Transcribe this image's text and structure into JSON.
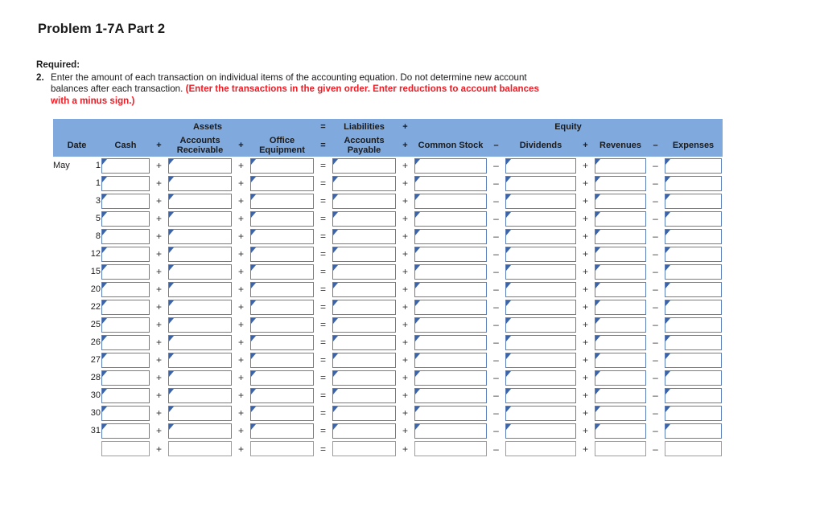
{
  "page_title": "Problem 1-7A Part 2",
  "instructions": {
    "required_label": "Required:",
    "item_number": "2.",
    "text_part1": "Enter the amount of each transaction on individual items of the accounting equation. Do not determine new account balances after each transaction. ",
    "text_emphasis": "(Enter the transactions in the given order. Enter reductions to account balances with a minus sign.)",
    "emphasis_color": "#ee1c25"
  },
  "table": {
    "header_bg": "#80a9dd",
    "input_border_color": "#5b7fbd",
    "group_headers": {
      "date_blank": "",
      "assets": "Assets",
      "eq1": "=",
      "liabilities": "Liabilities",
      "plus1": "+",
      "equity": "Equity"
    },
    "column_headers": {
      "date": "Date",
      "cash": "Cash",
      "op_plus_1": "+",
      "accounts_receivable": "Accounts Receivable",
      "op_plus_2": "+",
      "office_equipment": "Office Equipment",
      "op_equals": "=",
      "accounts_payable": "Accounts Payable",
      "op_plus_3": "+",
      "common_stock": "Common Stock",
      "op_minus_1": "–",
      "dividends": "Dividends",
      "op_plus_4": "+",
      "revenues": "Revenues",
      "op_minus_2": "–",
      "expenses": "Expenses"
    },
    "row_operators": {
      "plus": "+",
      "minus": "–",
      "equals": "="
    },
    "rows": [
      {
        "month": "May",
        "day": "1",
        "cash": "",
        "accounts_receivable": "",
        "office_equipment": "",
        "accounts_payable": "",
        "common_stock": "",
        "dividends": "",
        "revenues": "",
        "expenses": ""
      },
      {
        "month": "",
        "day": "1",
        "cash": "",
        "accounts_receivable": "",
        "office_equipment": "",
        "accounts_payable": "",
        "common_stock": "",
        "dividends": "",
        "revenues": "",
        "expenses": ""
      },
      {
        "month": "",
        "day": "3",
        "cash": "",
        "accounts_receivable": "",
        "office_equipment": "",
        "accounts_payable": "",
        "common_stock": "",
        "dividends": "",
        "revenues": "",
        "expenses": ""
      },
      {
        "month": "",
        "day": "5",
        "cash": "",
        "accounts_receivable": "",
        "office_equipment": "",
        "accounts_payable": "",
        "common_stock": "",
        "dividends": "",
        "revenues": "",
        "expenses": ""
      },
      {
        "month": "",
        "day": "8",
        "cash": "",
        "accounts_receivable": "",
        "office_equipment": "",
        "accounts_payable": "",
        "common_stock": "",
        "dividends": "",
        "revenues": "",
        "expenses": ""
      },
      {
        "month": "",
        "day": "12",
        "cash": "",
        "accounts_receivable": "",
        "office_equipment": "",
        "accounts_payable": "",
        "common_stock": "",
        "dividends": "",
        "revenues": "",
        "expenses": ""
      },
      {
        "month": "",
        "day": "15",
        "cash": "",
        "accounts_receivable": "",
        "office_equipment": "",
        "accounts_payable": "",
        "common_stock": "",
        "dividends": "",
        "revenues": "",
        "expenses": ""
      },
      {
        "month": "",
        "day": "20",
        "cash": "",
        "accounts_receivable": "",
        "office_equipment": "",
        "accounts_payable": "",
        "common_stock": "",
        "dividends": "",
        "revenues": "",
        "expenses": ""
      },
      {
        "month": "",
        "day": "22",
        "cash": "",
        "accounts_receivable": "",
        "office_equipment": "",
        "accounts_payable": "",
        "common_stock": "",
        "dividends": "",
        "revenues": "",
        "expenses": ""
      },
      {
        "month": "",
        "day": "25",
        "cash": "",
        "accounts_receivable": "",
        "office_equipment": "",
        "accounts_payable": "",
        "common_stock": "",
        "dividends": "",
        "revenues": "",
        "expenses": ""
      },
      {
        "month": "",
        "day": "26",
        "cash": "",
        "accounts_receivable": "",
        "office_equipment": "",
        "accounts_payable": "",
        "common_stock": "",
        "dividends": "",
        "revenues": "",
        "expenses": ""
      },
      {
        "month": "",
        "day": "27",
        "cash": "",
        "accounts_receivable": "",
        "office_equipment": "",
        "accounts_payable": "",
        "common_stock": "",
        "dividends": "",
        "revenues": "",
        "expenses": ""
      },
      {
        "month": "",
        "day": "28",
        "cash": "",
        "accounts_receivable": "",
        "office_equipment": "",
        "accounts_payable": "",
        "common_stock": "",
        "dividends": "",
        "revenues": "",
        "expenses": ""
      },
      {
        "month": "",
        "day": "30",
        "cash": "",
        "accounts_receivable": "",
        "office_equipment": "",
        "accounts_payable": "",
        "common_stock": "",
        "dividends": "",
        "revenues": "",
        "expenses": ""
      },
      {
        "month": "",
        "day": "30",
        "cash": "",
        "accounts_receivable": "",
        "office_equipment": "",
        "accounts_payable": "",
        "common_stock": "",
        "dividends": "",
        "revenues": "",
        "expenses": ""
      },
      {
        "month": "",
        "day": "31",
        "cash": "",
        "accounts_receivable": "",
        "office_equipment": "",
        "accounts_payable": "",
        "common_stock": "",
        "dividends": "",
        "revenues": "",
        "expenses": ""
      }
    ],
    "totals_row": {
      "month": "",
      "day": "",
      "cash": "",
      "accounts_receivable": "",
      "office_equipment": "",
      "accounts_payable": "",
      "common_stock": "",
      "dividends": "",
      "revenues": "",
      "expenses": ""
    }
  }
}
